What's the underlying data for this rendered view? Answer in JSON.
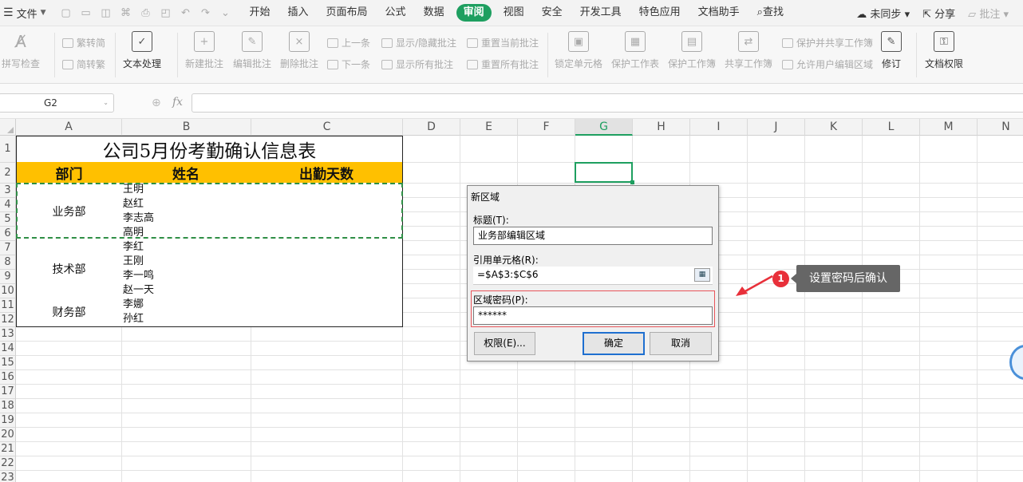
{
  "menubar": {
    "file_label": "文件",
    "tabs": [
      "开始",
      "插入",
      "页面布局",
      "公式",
      "数据",
      "审阅",
      "视图",
      "安全",
      "开发工具",
      "特色应用",
      "文档助手"
    ],
    "active_tab": "审阅",
    "search_label": "查找",
    "sync_label": "未同步",
    "share_label": "分享",
    "comment_label": "批注"
  },
  "ribbon": {
    "spellcheck": "拼写检查",
    "trad_to_simp": "繁转简",
    "simp_to_trad": "简转繁",
    "text_process": "文本处理",
    "new_comment": "新建批注",
    "edit_comment": "编辑批注",
    "delete_comment": "删除批注",
    "prev": "上一条",
    "next": "下一条",
    "show_hide_comment": "显示/隐藏批注",
    "show_all_comments": "显示所有批注",
    "reset_current_comment": "重置当前批注",
    "reset_all_comments": "重置所有批注",
    "lock_cell": "锁定单元格",
    "protect_sheet": "保护工作表",
    "protect_workbook": "保护工作簿",
    "share_workbook": "共享工作簿",
    "protect_share_workbook": "保护并共享工作簿",
    "allow_user_edit": "允许用户编辑区域",
    "revise": "修订",
    "doc_permission": "文档权限"
  },
  "formula_bar": {
    "name_box": "G2",
    "fx": "fx",
    "content": ""
  },
  "sheet": {
    "columns": [
      "A",
      "B",
      "C",
      "D",
      "E",
      "F",
      "G",
      "H",
      "I",
      "J",
      "K",
      "L",
      "M",
      "N"
    ],
    "rows": [
      "1",
      "2",
      "3",
      "4",
      "5",
      "6",
      "7",
      "8",
      "9",
      "10",
      "11",
      "12",
      "13",
      "14",
      "15",
      "16",
      "17",
      "18",
      "19",
      "20",
      "21",
      "22",
      "23"
    ],
    "selected_column": "G",
    "table": {
      "title": "公司5月份考勤确认信息表",
      "headers": [
        "部门",
        "姓名",
        "出勤天数"
      ],
      "departments": [
        {
          "name": "业务部",
          "members": [
            "王明",
            "赵红",
            "李志高",
            "高明"
          ]
        },
        {
          "name": "技术部",
          "members": [
            "李红",
            "王刚",
            "李一鸣",
            "赵一天"
          ]
        },
        {
          "name": "财务部",
          "members": [
            "李娜",
            "孙红"
          ]
        }
      ]
    }
  },
  "dialog": {
    "title": "新区域",
    "title_label": "标题(T):",
    "title_value": "业务部编辑区域",
    "ref_label": "引用单元格(R):",
    "ref_value": "=$A$3:$C$6",
    "password_label": "区域密码(P):",
    "password_value": "******",
    "permission_button": "权限(E)...",
    "ok_button": "确定",
    "cancel_button": "取消"
  },
  "callout": {
    "step": "1",
    "text": "设置密码后确认"
  }
}
